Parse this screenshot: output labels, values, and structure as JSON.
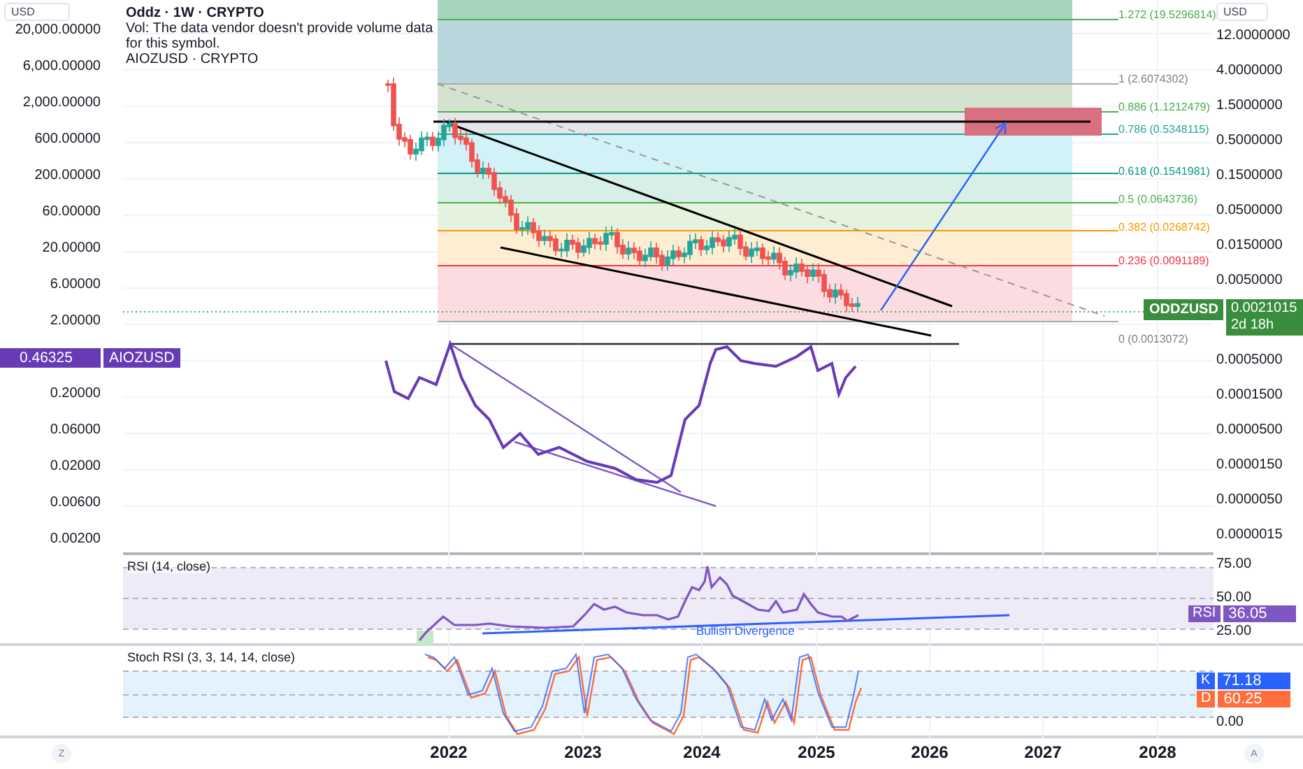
{
  "main_pane": {
    "legend": {
      "title": "Oddz · 1W · CRYPTO",
      "volume_note": "Vol: The data vendor doesn't provide volume data for this symbol.",
      "compare_symbol": "AIOZUSD · CRYPTO"
    },
    "left_axis": {
      "currency": "USD",
      "ticks": [
        "20,000.00000",
        "6,000.00000",
        "2,000.00000",
        "600.00000",
        "200.00000",
        "60.00000",
        "20.00000",
        "6.00000",
        "2.00000",
        "0.20000",
        "0.06000",
        "0.02000",
        "0.00600",
        "0.00200"
      ],
      "badge": {
        "value": "0.46325",
        "symbol": "AIOZUSD"
      }
    },
    "right_axis": {
      "currency": "USD",
      "ticks_above": [
        "12.0000000",
        "4.0000000",
        "1.5000000",
        "0.5000000",
        "0.1500000",
        "0.0500000",
        "0.0150000",
        "0.0050000"
      ],
      "ticks_below": [
        "0.0005000",
        "0.0001500",
        "0.0000500",
        "0.0000150",
        "0.0000050",
        "0.0000015"
      ],
      "badge": {
        "symbol": "ODDZUSD",
        "price": "0.0021015",
        "countdown": "2d 18h"
      }
    },
    "fib_levels": [
      {
        "label": "1.272 (19.5296814)",
        "color": "#4caf50"
      },
      {
        "label": "1 (2.6074302)",
        "color": "#808080"
      },
      {
        "label": "0.886 (1.1212479)",
        "color": "#4caf50"
      },
      {
        "label": "0.786 (0.5348115)",
        "color": "#26a69a"
      },
      {
        "label": "0.618 (0.1541981)",
        "color": "#089981"
      },
      {
        "label": "0.5 (0.0643736)",
        "color": "#4caf50"
      },
      {
        "label": "0.382 (0.0268742)",
        "color": "#ff9800"
      },
      {
        "label": "0.236 (0.0091189)",
        "color": "#f23645"
      },
      {
        "label": "0 (0.0013072)",
        "color": "#808080"
      }
    ]
  },
  "rsi_pane": {
    "title": "RSI (14, close)",
    "annotation": "Bullish Divergence",
    "axis_ticks": [
      "75.00",
      "50.00",
      "25.00"
    ],
    "badge": {
      "name": "RSI",
      "value": "36.05"
    }
  },
  "stoch_pane": {
    "title": "Stoch RSI (3, 3, 14, 14, close)",
    "axis_ticks": [
      "0.00"
    ],
    "badges": [
      {
        "name": "K",
        "value": "71.18",
        "color": "#2962ff"
      },
      {
        "name": "D",
        "value": "60.25",
        "color": "#ff6d3a"
      }
    ]
  },
  "time_axis": {
    "years": [
      "2022",
      "2023",
      "2024",
      "2025",
      "2026",
      "2027",
      "2028"
    ]
  },
  "corner_buttons": {
    "left": "Z",
    "right": "A"
  }
}
